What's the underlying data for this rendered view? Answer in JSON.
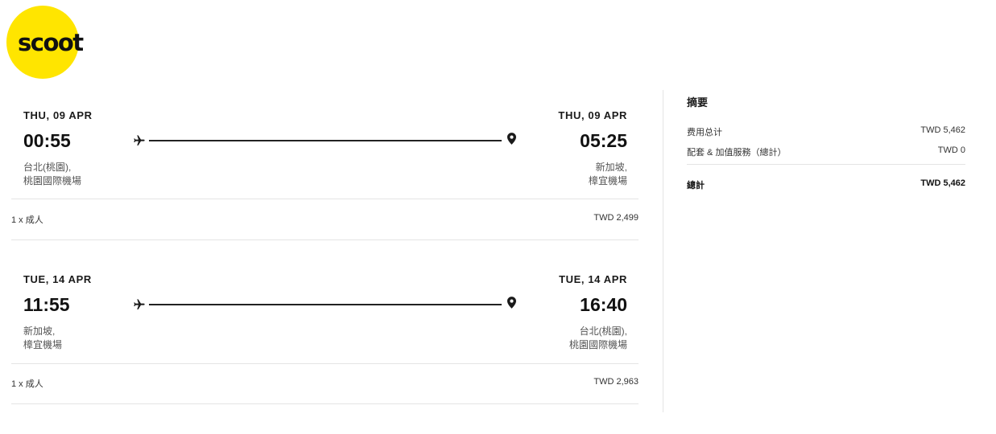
{
  "brand": {
    "logo_text": "scoot",
    "logo_color": "#FFE500"
  },
  "flights": [
    {
      "dep_date": "THU, 09 APR",
      "dep_time": "00:55",
      "dep_city": "台北(桃園),",
      "dep_airport": "桃園國際機場",
      "arr_date": "THU, 09 APR",
      "arr_time": "05:25",
      "arr_city": "新加坡,",
      "arr_airport": "樟宜機場",
      "plane_icon": "airplane-icon",
      "pin_icon": "map-pin-icon",
      "passengers": "1 x 成人",
      "price": "TWD 2,499"
    },
    {
      "dep_date": "TUE, 14 APR",
      "dep_time": "11:55",
      "dep_city": "新加坡,",
      "dep_airport": "樟宜機場",
      "arr_date": "TUE, 14 APR",
      "arr_time": "16:40",
      "arr_city": "台北(桃園),",
      "arr_airport": "桃園國際機場",
      "plane_icon": "airplane-icon",
      "pin_icon": "map-pin-icon",
      "passengers": "1 x 成人",
      "price": "TWD 2,963"
    }
  ],
  "summary": {
    "title": "摘要",
    "fare_label": "费用总计",
    "fare_value": "TWD 5,462",
    "addons_label": "配套 & 加值服務（總計）",
    "addons_value": "TWD 0",
    "total_label": "總計",
    "total_value": "TWD 5,462"
  }
}
